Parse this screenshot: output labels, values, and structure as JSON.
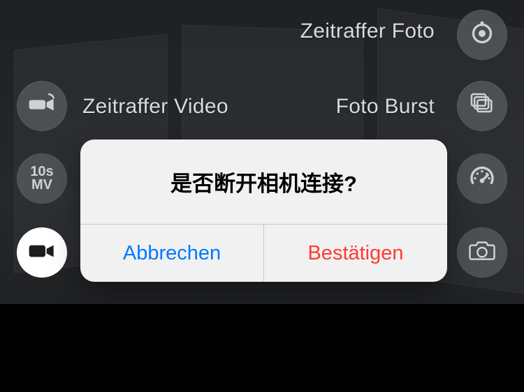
{
  "modes": {
    "timelapse_photo": {
      "label": "Zeitraffer Foto",
      "icon": "timelapse-photo-icon"
    },
    "timelapse_video": {
      "label": "Zeitraffer Video",
      "icon": "timelapse-video-icon"
    },
    "burst_photo": {
      "label": "Foto Burst",
      "icon": "burst-icon"
    },
    "ten_sec_mv": {
      "label": "10s MV",
      "icon": "10s-mv",
      "text1": "10s",
      "text2": "MV"
    },
    "speedometer": {
      "label": "",
      "icon": "speedometer-icon"
    },
    "video": {
      "label": "",
      "icon": "video-icon"
    },
    "photo": {
      "label": "",
      "icon": "photo-icon"
    }
  },
  "alert": {
    "title": "是否断开相机连接?",
    "cancel_label": "Abbrechen",
    "confirm_label": "Bestätigen"
  }
}
